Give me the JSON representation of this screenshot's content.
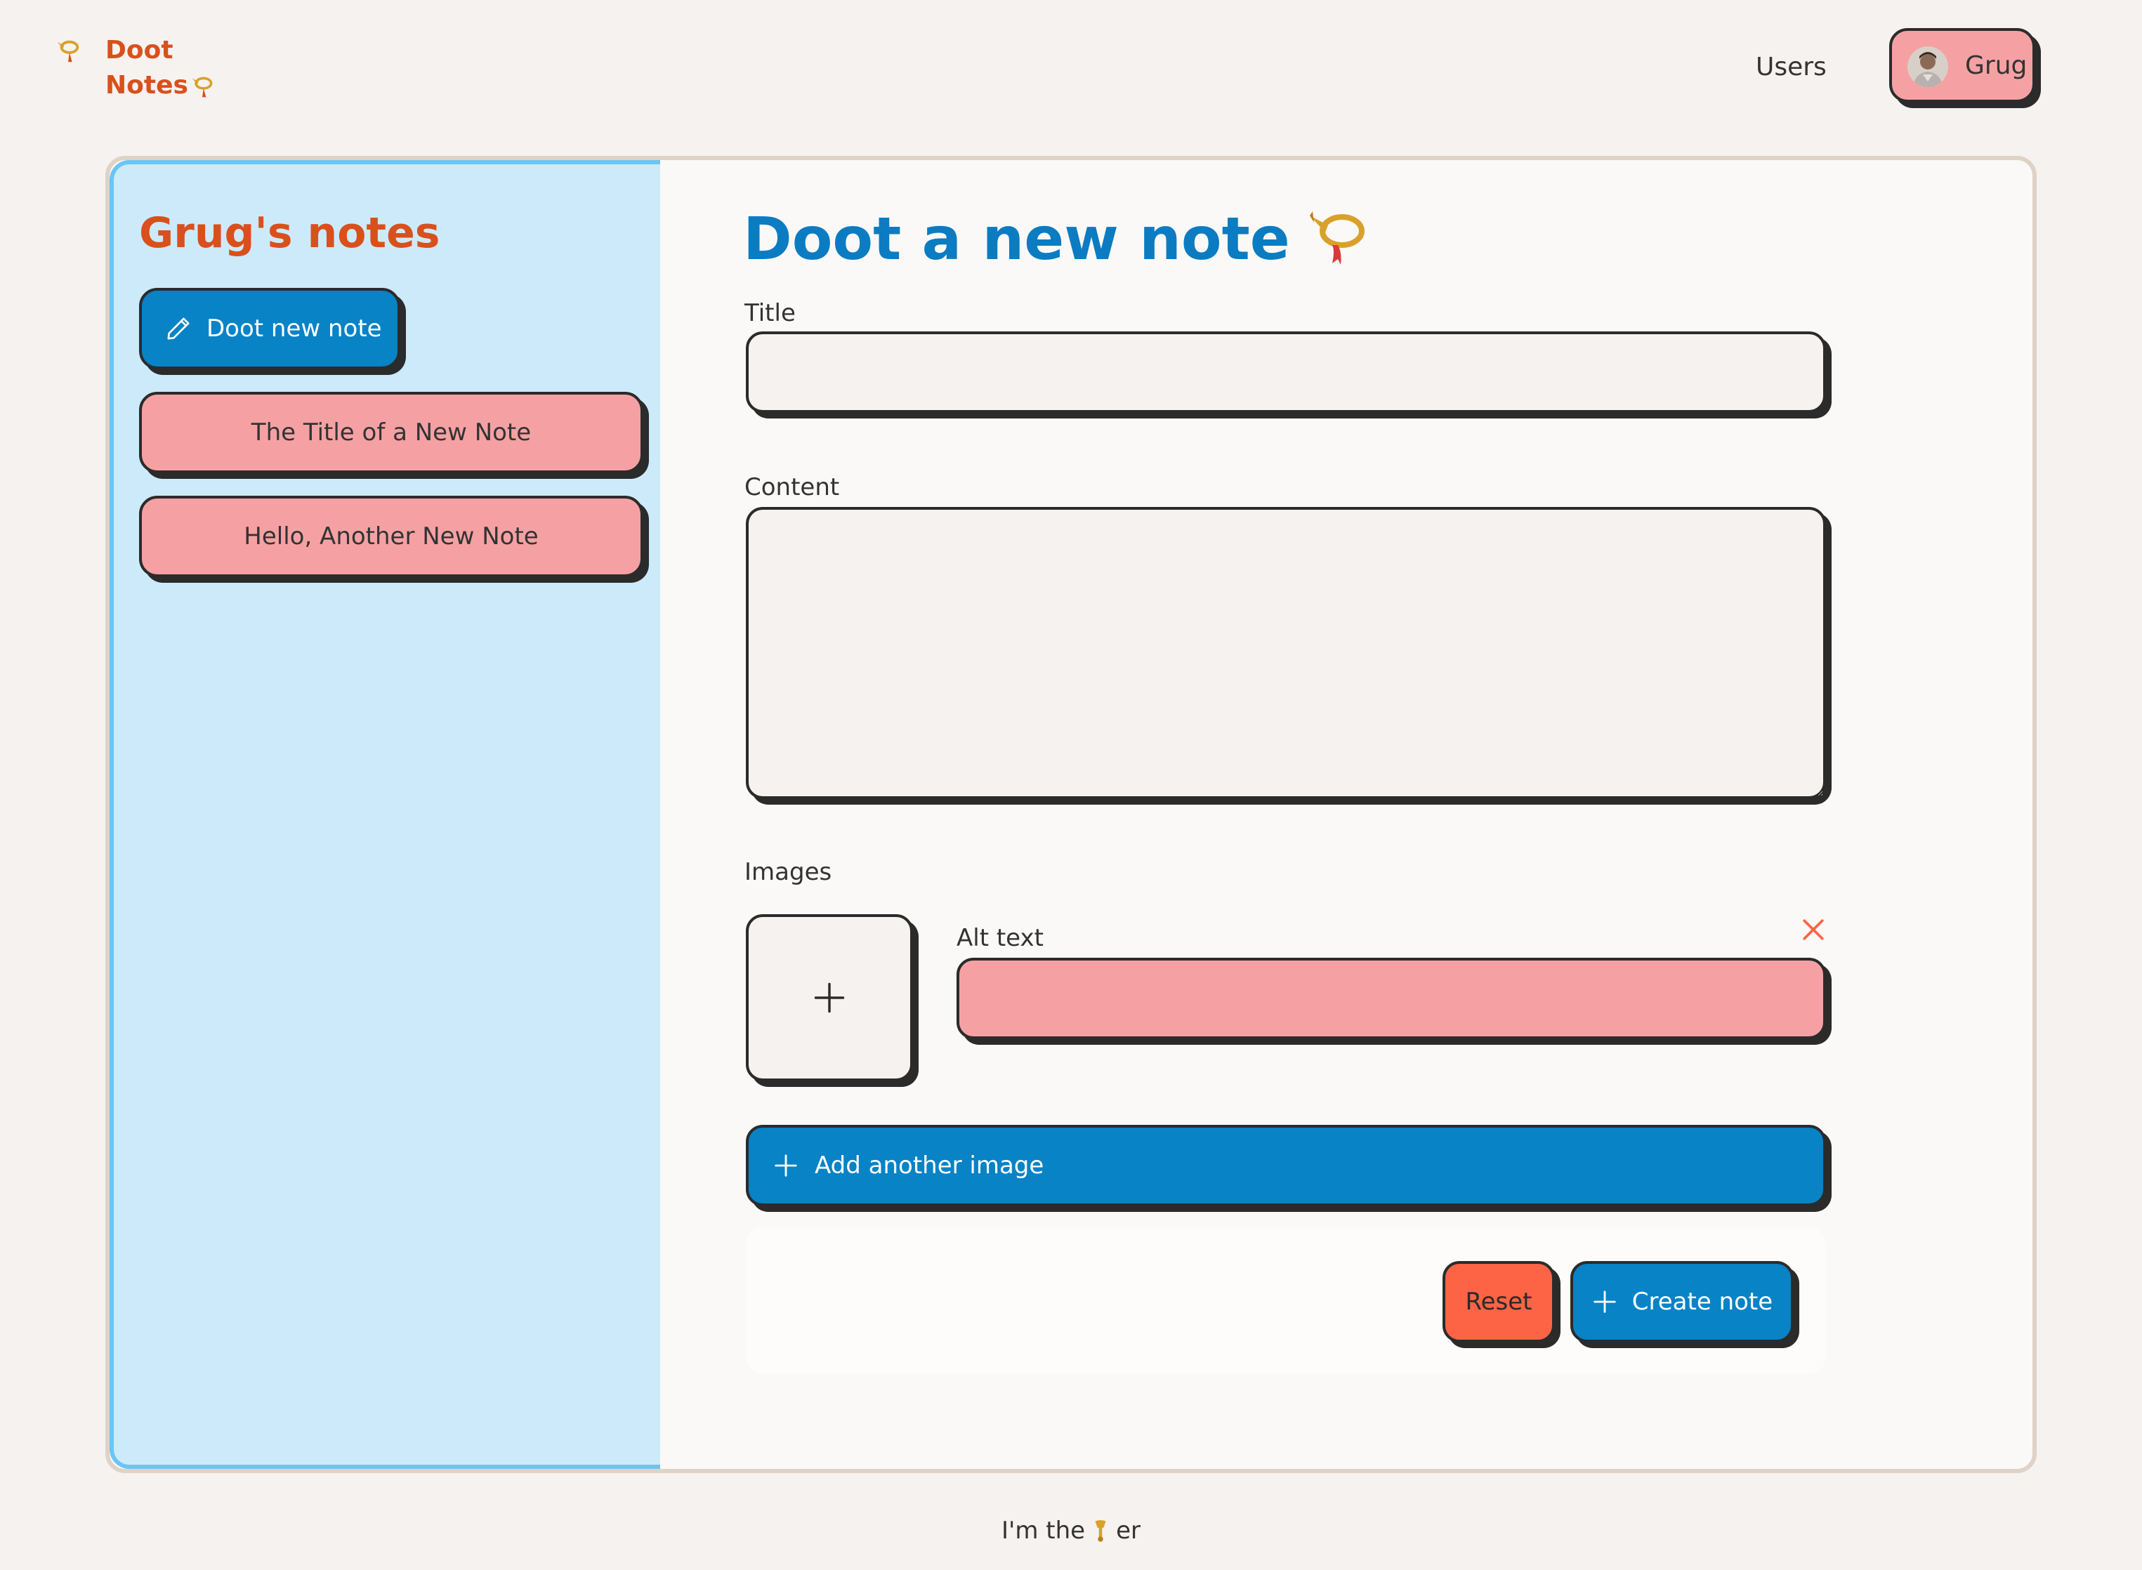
{
  "header": {
    "logo_line_1": "Doot",
    "logo_line_2": "Notes",
    "logo_icon": "postal-horn-icon",
    "nav_users": "Users",
    "user_name": "Grug"
  },
  "sidebar": {
    "title": "Grug's notes",
    "new_note_label": "Doot new note",
    "notes": [
      {
        "title": "The Title of a New Note"
      },
      {
        "title": "Hello, Another New Note"
      }
    ]
  },
  "form": {
    "heading": "Doot a new note",
    "heading_icon": "postal-horn-icon",
    "title_label": "Title",
    "title_value": "",
    "content_label": "Content",
    "content_value": "",
    "images_label": "Images",
    "alt_text_label": "Alt text",
    "alt_text_value": "",
    "add_image_label": "Add another image",
    "reset_label": "Reset",
    "create_label": "Create note"
  },
  "footer": {
    "text_before": "I'm the",
    "text_after": "er",
    "icon": "trumpet-icon"
  },
  "colors": {
    "background": "#f6f2ef",
    "brand_orange": "#d9501d",
    "brand_blue": "#0783c6",
    "heading_blue": "#0b7cc1",
    "sidebar_bg": "#cdeafb",
    "sidebar_border": "#6ac5f5",
    "pink": "#f5a1a3",
    "reset_red": "#fd6445",
    "outline": "#2b2b2b"
  }
}
